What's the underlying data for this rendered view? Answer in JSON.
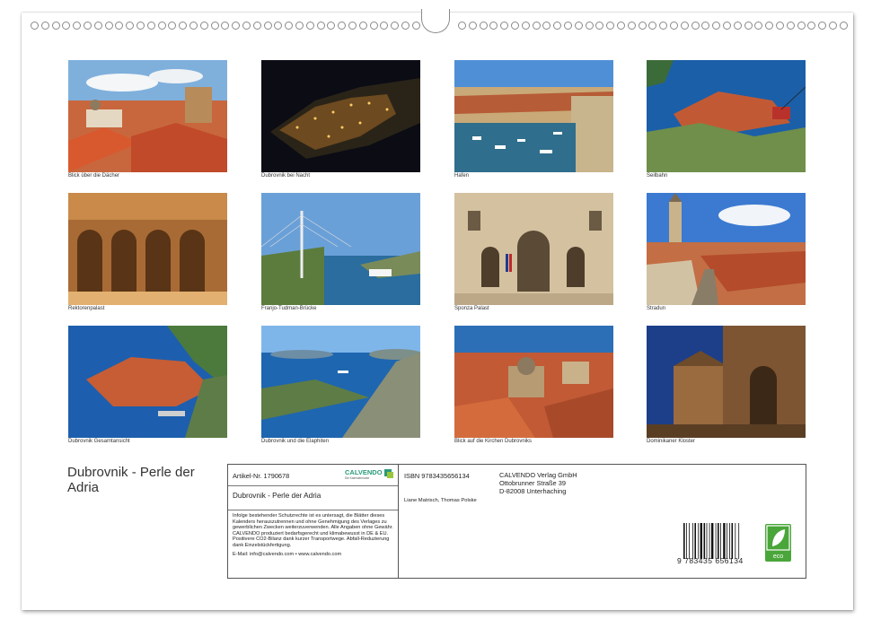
{
  "calendar_title": "Dubrovnik - Perle der Adria",
  "photos": [
    {
      "caption": "Blick über die Dächer"
    },
    {
      "caption": "Dubrovnik bei Nacht"
    },
    {
      "caption": "Hafen"
    },
    {
      "caption": "Seilbahn"
    },
    {
      "caption": "Rektorenpalast"
    },
    {
      "caption": "Franjo-Tudman-Brücke"
    },
    {
      "caption": "Sponza Palast"
    },
    {
      "caption": "Stradun"
    },
    {
      "caption": "Dubrovnik Gesamtansicht"
    },
    {
      "caption": "Dubrovnik und die Elaphiten"
    },
    {
      "caption": "Blick auf die Kirchen Dubrovniks"
    },
    {
      "caption": "Dominikaner Kloster"
    }
  ],
  "info": {
    "article_no": "Artikel-Nr. 1790678",
    "logo_text": "CALVENDO",
    "logo_sub": "Die Kalendermarke",
    "product_title": "Dubrovnik - Perle der Adria",
    "isbn": "ISBN 9783435656134",
    "authors": "Liane Matrisch, Thomas Polske",
    "publisher": [
      "CALVENDO Verlag GmbH",
      "Ottobrunner Straße 39",
      "D-82008 Unterhaching"
    ],
    "legal": "Infolge bestehender Schutzrechte ist es untersagt, die Blätter dieses Kalenders herauszutrennen und ohne Genehmigung des Verlages zu gewerblichen Zwecken weiterzuverwenden. Alle Angaben ohne Gewähr. CALVENDO produziert bedarfsgerecht und klimabewusst in DE & EU. Positivere CO2-Bilanz dank kurzer Transportwege. Abfall-Reduzierung dank Einzelstückfertigung.",
    "contact": "E-Mail: info@calvendo.com • www.calvendo.com",
    "barcode_number": "9 783435 656134",
    "eco_label": "eco"
  }
}
